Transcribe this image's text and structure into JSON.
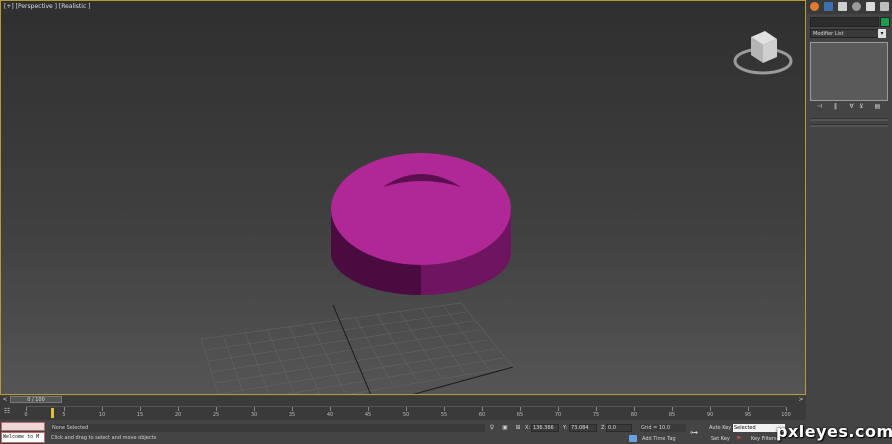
{
  "viewport": {
    "label": "[+] [Perspective ] [Realistic ]",
    "object_color": "#b02796",
    "grid_color": "#6a6a6a"
  },
  "command_panel": {
    "tabs": [
      "create-icon",
      "modify-icon",
      "hierarchy-icon",
      "motion-icon",
      "display-icon",
      "utilities-icon"
    ],
    "modifier_list_label": "Modifier List",
    "object_color": "#1f9a4e",
    "stack_buttons": [
      "pin-stack-icon",
      "show-end-result-icon",
      "make-unique-icon",
      "remove-modifier-icon",
      "configure-modifier-sets-icon"
    ]
  },
  "time_slider": {
    "frame_readout": "0 / 100",
    "prev_glyph": "<",
    "next_glyph": ">"
  },
  "track_bar": {
    "ticks": [
      "0",
      "5",
      "10",
      "15",
      "20",
      "25",
      "30",
      "35",
      "40",
      "45",
      "50",
      "55",
      "60",
      "65",
      "70",
      "75",
      "80",
      "85",
      "90",
      "95",
      "100"
    ]
  },
  "status_bar": {
    "maxscript_text": "Welcome to M",
    "selection_status": "None Selected",
    "prompt": "Click and drag to select and move objects",
    "x_label": "X:",
    "x_value": "136.366",
    "y_label": "Y:",
    "y_value": "73.084",
    "z_label": "Z:",
    "z_value": "0.0",
    "grid": "Grid = 10.0",
    "add_time_tag": "Add Time Tag",
    "auto_key": "Auto Key",
    "set_key": "Set Key",
    "selected_option": "Selected",
    "key_filters": "Key Filters..."
  },
  "watermark": "pxleyes.com"
}
